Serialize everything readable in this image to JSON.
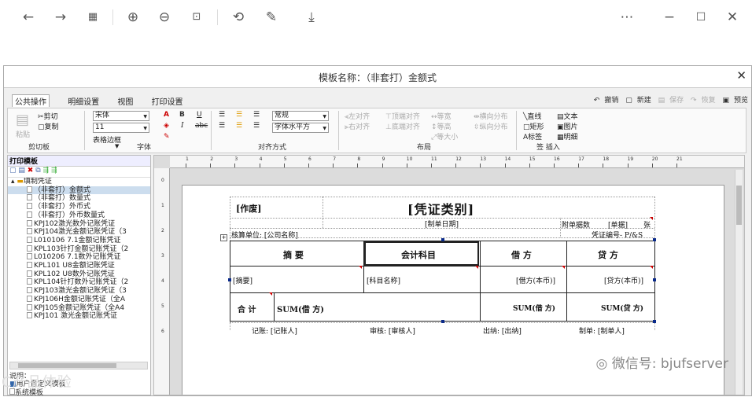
{
  "window_title": "模板名称：（非套打）金额式",
  "ribbon": {
    "tabs": [
      "公共操作",
      "明细设置",
      "视图",
      "打印设置"
    ],
    "right_actions": [
      "撤销",
      "新建",
      "保存",
      "恢复",
      "预览"
    ],
    "clipboard": {
      "paste": "粘贴",
      "cut": "剪切",
      "copy": "复制",
      "label": "剪切板"
    },
    "font": {
      "family": "宋体",
      "size": "11",
      "border": "表格边框",
      "label": "字体"
    },
    "align": {
      "style": "常规",
      "direction": "字体水平方",
      "label": "对齐方式"
    },
    "layout": {
      "items": [
        "左对齐",
        "右对齐",
        "顶端对齐",
        "底端对齐",
        "等宽",
        "等高",
        "等大小",
        "横向分布",
        "纵向分布"
      ],
      "label": "布局"
    },
    "insert": {
      "items": [
        "直线",
        "矩形",
        "标签",
        "文本",
        "图片",
        "明细"
      ],
      "label": "签 插入"
    }
  },
  "left_panel": {
    "title": "打印模板",
    "tree_root": "填制凭证",
    "items": [
      "（非套打）金额式",
      "（非套打）数量式",
      "（非套打）外币式",
      "（非套打）外币数量式",
      "KPJ102激光数外记账凭证",
      "KPJ104激光金额记账凭证（3",
      "L010106 7.1金额记账凭证",
      "KPL103针打金额记账凭证（2",
      "L010206 7.1数外记账凭证",
      "KPL101 U8金额记账凭证",
      "KPL102 U8数外记账凭证",
      "KPL104针打数外记账凭证（2",
      "KPJ103激光金额记账凭证（3",
      "KPJ106H金额记账凭证（全A",
      "KPJ105金额记账凭证（全A4",
      "KPJ101 激光金额记账凭证"
    ],
    "desc_label": "说明：",
    "desc_items": [
      "用户自定义模板",
      "系统模板"
    ]
  },
  "ruler_h": [
    "1",
    "2",
    "3",
    "4",
    "5",
    "6",
    "7",
    "8",
    "9",
    "10",
    "11",
    "12",
    "13",
    "14",
    "15",
    "16",
    "17",
    "18",
    "19",
    "20",
    "21"
  ],
  "ruler_v": [
    "0",
    "1",
    "2",
    "3",
    "4",
    "5",
    "6"
  ],
  "voucher": {
    "void": "[作废]",
    "category": "[凭证类别]",
    "date": "[制单日期]",
    "attach": "附单据数",
    "attach_val": "[单据]",
    "attach_unit": "张",
    "unit": "核算单位: [公司名称]",
    "serial": "凭证编号- P/&S",
    "headers": [
      "摘 要",
      "会计科目",
      "借 方",
      "贷 方"
    ],
    "row": [
      "[摘要]",
      "[科目名称]",
      "[借方(本币)]",
      "[贷方(本币)]"
    ],
    "total_label": "合 计",
    "total_sum": "SUM(借 方)",
    "total_debit": "SUM(借 方)",
    "total_credit": "SUM(贷 方)",
    "footer": [
      "记账: [记账人]",
      "审核: [审核人]",
      "出纳: [出纳]",
      "制单: [制单人]"
    ]
  },
  "watermark": "微信号: bjufserver",
  "watermark2": "C产品体验"
}
